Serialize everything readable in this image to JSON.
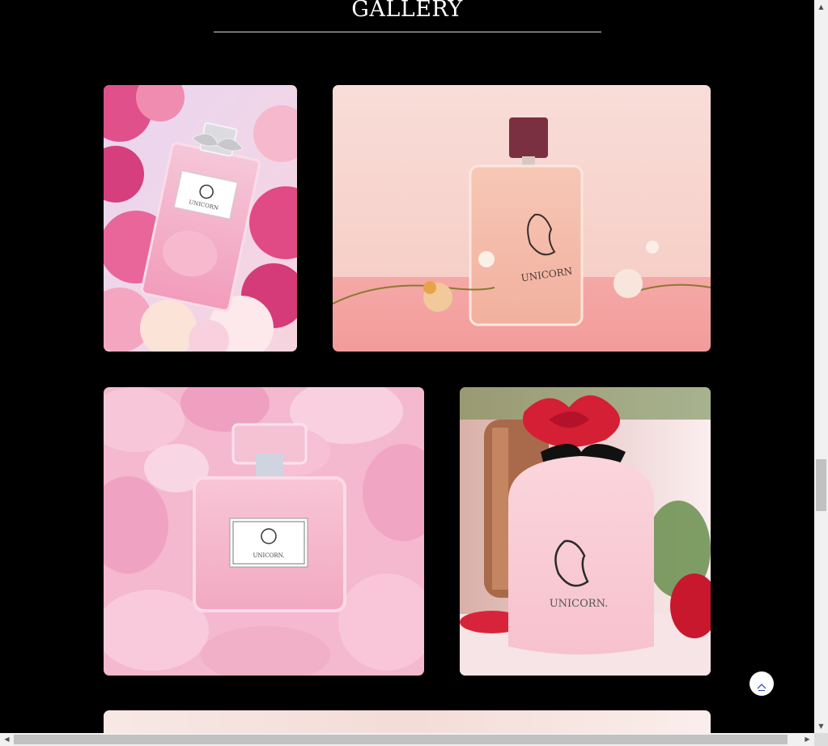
{
  "gallery": {
    "title": "GALLERY",
    "images": [
      {
        "name": "pink-perfume-with-peonies",
        "brand_label": "UNICORN"
      },
      {
        "name": "amber-perfume-on-pink-table",
        "brand_label": "UNICORN"
      },
      {
        "name": "perfume-on-rose-petals",
        "brand_label": "UNICORN."
      },
      {
        "name": "frosted-perfume-red-flower-cap",
        "brand_label": "UNICORN."
      },
      {
        "name": "fifth-gallery-image-partial",
        "brand_label": ""
      }
    ]
  },
  "back_to_top": {
    "icon": "chevron-up-icon",
    "color": "#2a3cc0"
  },
  "colors": {
    "background": "#000000",
    "title": "#ffffff",
    "rule": "#d8d8d8"
  }
}
